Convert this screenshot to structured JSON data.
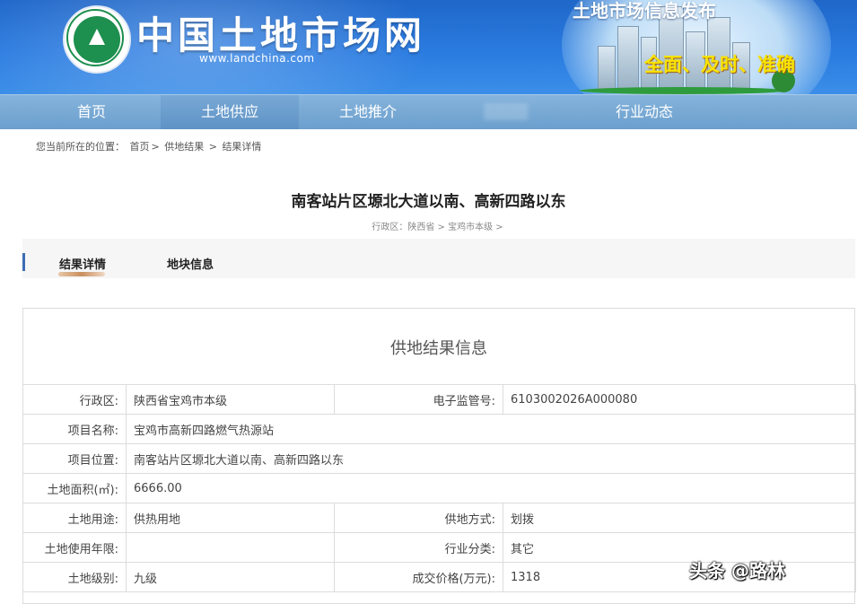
{
  "header": {
    "site_title": "中国土地市场网",
    "site_url": "www.landchina.com",
    "banner_title": "土地市场信息发布",
    "banner_slogan": "全面、及时、准确"
  },
  "nav": {
    "items": [
      {
        "label": "首页"
      },
      {
        "label": "土地供应"
      },
      {
        "label": "土地推介"
      },
      {
        "label": "▒▒▒▒"
      },
      {
        "label": "行业动态"
      }
    ]
  },
  "breadcrumb": {
    "prefix": "您当前所在的位置：",
    "items": [
      "首页",
      ">",
      "供地结果",
      ">",
      "结果详情"
    ]
  },
  "page": {
    "title": "南客站片区塬北大道以南、高新四路以东",
    "sub_crumb": "行政区：陕西省 > 宝鸡市本级 >"
  },
  "tabs": [
    {
      "label": "结果详情"
    },
    {
      "label": "地块信息"
    }
  ],
  "result": {
    "title": "供地结果信息",
    "rows": [
      {
        "cells": [
          "行政区:",
          "陕西省宝鸡市本级",
          "电子监管号:",
          "6103002026A000080"
        ]
      },
      {
        "cells": [
          "项目名称:",
          "宝鸡市高新四路燃气热源站"
        ]
      },
      {
        "cells": [
          "项目位置:",
          "南客站片区塬北大道以南、高新四路以东"
        ]
      },
      {
        "cells": [
          "土地面积(㎡):",
          "6666.00"
        ]
      },
      {
        "cells": [
          "土地用途:",
          "供热用地",
          "供地方式:",
          "划拨"
        ]
      },
      {
        "cells": [
          "土地使用年限:",
          "",
          "行业分类:",
          "其它"
        ]
      },
      {
        "cells": [
          "土地级别:",
          "九级",
          "成交价格(万元):",
          "1318"
        ]
      }
    ]
  },
  "watermark": "头条 @路林"
}
